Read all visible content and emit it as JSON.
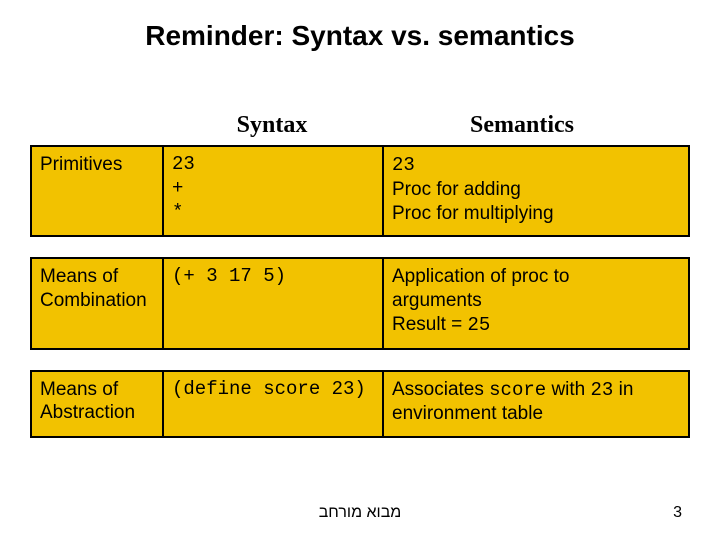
{
  "title": "Reminder: Syntax vs. semantics",
  "headers": {
    "syntax": "Syntax",
    "semantics": "Semantics"
  },
  "rows": [
    {
      "label": "Primitives",
      "syntax": "23\n+\n*",
      "semantics_html": "<span class=\"mono\">23</span><br>Proc for adding<br>Proc for multiplying"
    },
    {
      "label": "Means of Combination",
      "syntax": "(+ 3 17 5)",
      "semantics_html": "Application of proc to arguments<br>Result = <span class=\"mono\">25</span>"
    },
    {
      "label": "Means of Abstraction",
      "syntax": "(define score 23)",
      "semantics_html": "Associates <span class=\"mono\">score</span> with <span class=\"mono\">23</span> in environment table"
    }
  ],
  "footer_center": "מבוא מורחב",
  "page_number": "3",
  "chart_data": {
    "type": "table",
    "columns": [
      "",
      "Syntax",
      "Semantics"
    ],
    "rows": [
      [
        "Primitives",
        "23 / + / *",
        "23 / Proc for adding / Proc for multiplying"
      ],
      [
        "Means of Combination",
        "(+ 3 17 5)",
        "Application of proc to arguments; Result = 25"
      ],
      [
        "Means of Abstraction",
        "(define score 23)",
        "Associates score with 23 in environment table"
      ]
    ]
  }
}
